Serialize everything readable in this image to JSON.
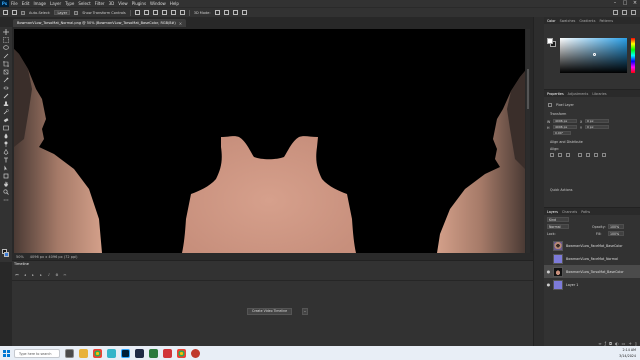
{
  "app": {
    "logo": "Ps",
    "menu": [
      "File",
      "Edit",
      "Image",
      "Layer",
      "Type",
      "Select",
      "Filter",
      "3D",
      "View",
      "Plugins",
      "Window",
      "Help"
    ]
  },
  "options_bar": {
    "auto_select_label": "Auto-Select:",
    "auto_select_value": "Layer",
    "show_transform_label": "Show Transform Controls",
    "mode_3d_label": "3D Mode:"
  },
  "document": {
    "tab_title": "BowmanVLow_TorsoMat_Normal.png @ 50% (BowmanVLow_TorsoMat_BaseColor, RGB/8#)",
    "close_glyph": "×"
  },
  "status_bar": {
    "zoom": "50%",
    "doc_size": "4096 px x 4096 px (72 ppi)"
  },
  "timeline": {
    "tab_label": "Timeline",
    "create_button_label": "Create Video Timeline",
    "dropdown_glyph": "⌄"
  },
  "color_panel": {
    "tabs": [
      "Color",
      "Swatches",
      "Gradients",
      "Patterns"
    ],
    "active_tab": "Color",
    "fg_color": "#ffffff",
    "bg_color": "#1a1a1a"
  },
  "properties_panel": {
    "tabs": [
      "Properties",
      "Adjustments",
      "Libraries"
    ],
    "layer_type": "Pixel Layer",
    "transform_label": "Transform",
    "w_value": "4096 px",
    "h_value": "4096 px",
    "x_value": "0 px",
    "y_value": "0 px",
    "angle_value": "0.00°",
    "align_label": "Align and Distribute",
    "align_sub": "Align:",
    "quick_actions": "Quick Actions"
  },
  "layers_panel": {
    "tabs": [
      "Layers",
      "Channels",
      "Paths"
    ],
    "kind_label": "Kind",
    "blend_mode": "Normal",
    "opacity_label": "Opacity:",
    "opacity_value": "100%",
    "lock_label": "Lock:",
    "fill_label": "Fill:",
    "fill_value": "100%",
    "layers": [
      {
        "name": "BowmanVLow_FaceMat_BaseColor",
        "visible": false,
        "thumb": "face"
      },
      {
        "name": "BowmanVLow_FaceMat_Normal",
        "visible": false,
        "thumb": "purple"
      },
      {
        "name": "BowmanVLow_TorsoMat_BaseColor",
        "visible": true,
        "thumb": "torso",
        "selected": true
      },
      {
        "name": "Layer 1",
        "visible": true,
        "thumb": "purple"
      }
    ],
    "footer_icons": [
      "link-icon",
      "fx-icon",
      "mask-icon",
      "adjustment-icon",
      "folder-icon",
      "new-layer-icon",
      "trash-icon"
    ]
  },
  "taskbar": {
    "search_placeholder": "Type here to search",
    "time": "2:14 AM",
    "date": "3/14/2024"
  }
}
